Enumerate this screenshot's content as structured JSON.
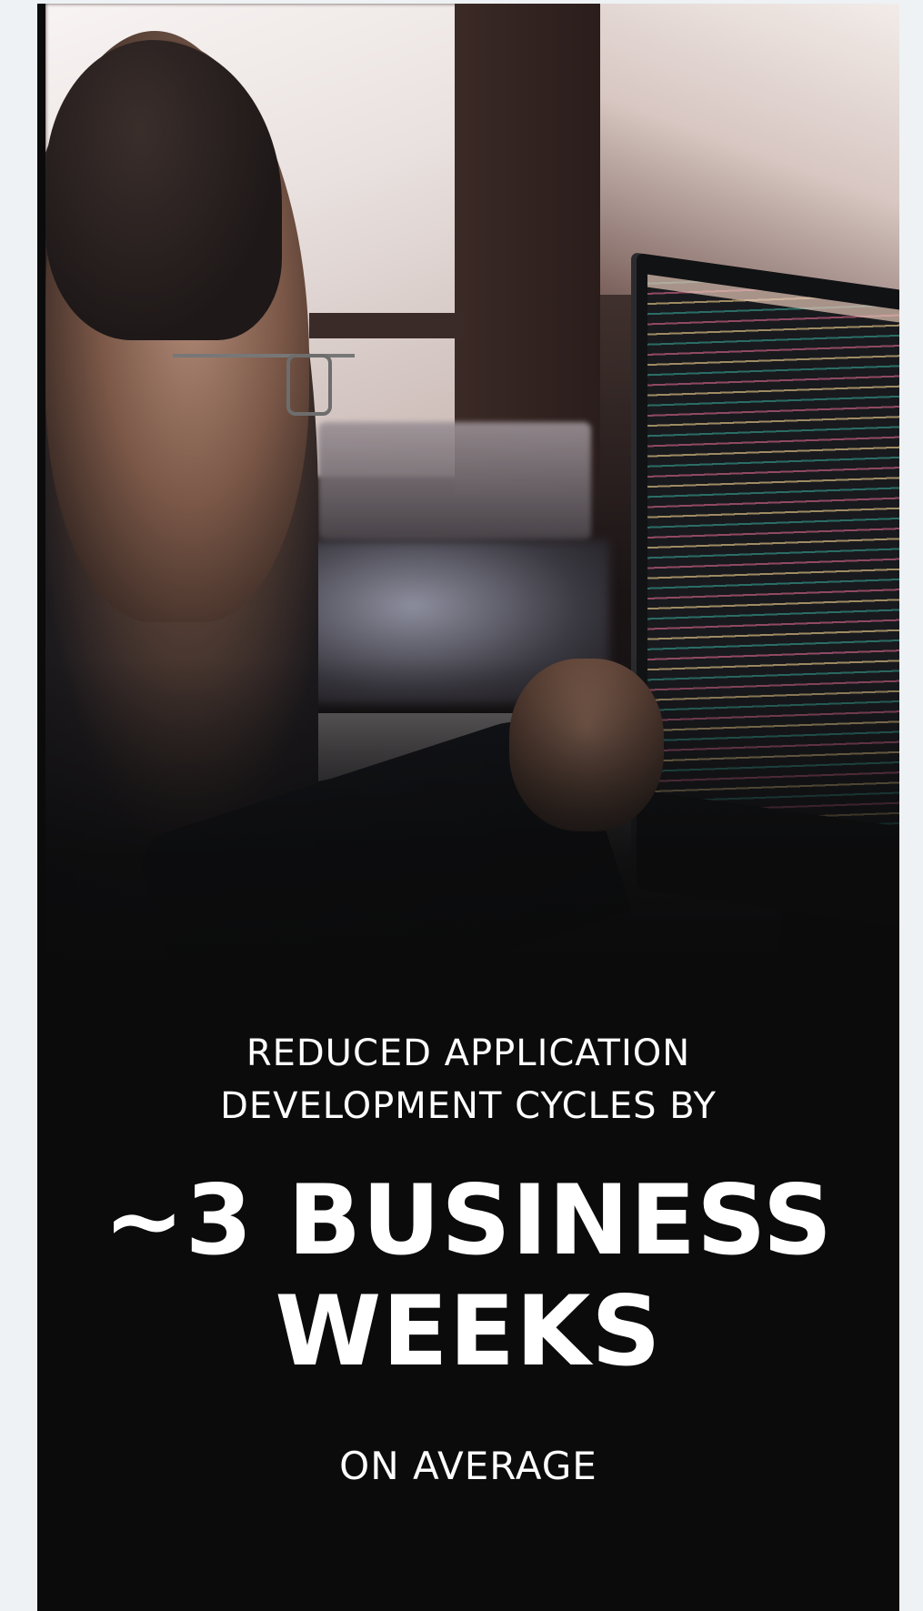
{
  "stat": {
    "lead_line_1": "REDUCED APPLICATION",
    "lead_line_2": "DEVELOPMENT CYCLES BY",
    "headline_line_1": "~3 BUSINESS",
    "headline_line_2": "WEEKS",
    "tail": "ON AVERAGE"
  },
  "colors": {
    "card_background": "#0b0b0c",
    "page_background": "#eef2f4",
    "text": "#ffffff"
  }
}
